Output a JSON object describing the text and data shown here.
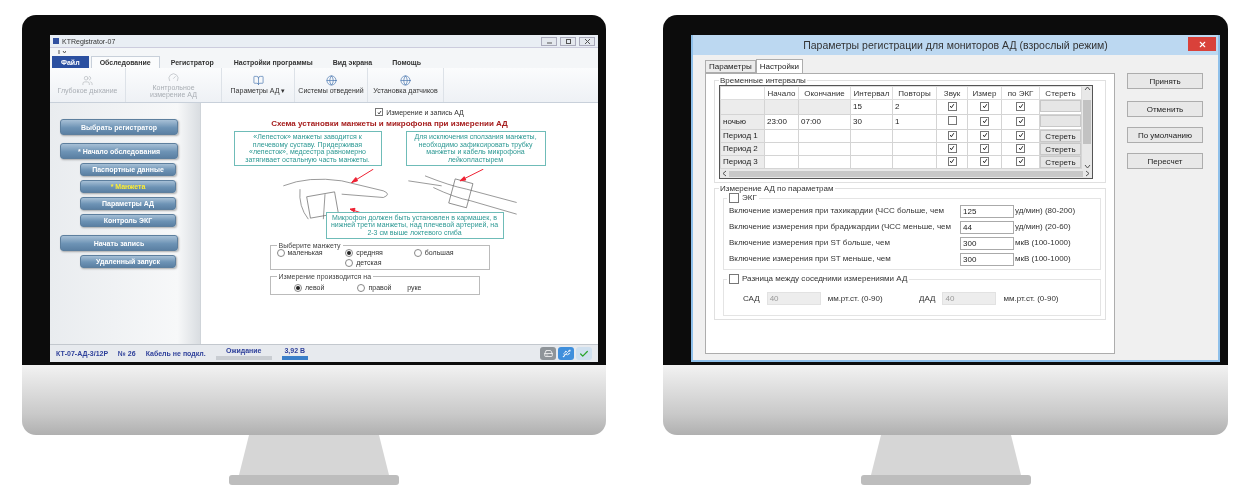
{
  "left_screen": {
    "window": {
      "title": "KTRegistrator-07"
    },
    "ribbon_tabs": [
      {
        "label": "Файл",
        "kind": "file",
        "selected": false
      },
      {
        "label": "Обследование",
        "kind": "tab",
        "selected": true
      },
      {
        "label": "Регистратор",
        "kind": "tab",
        "selected": false
      },
      {
        "label": "Настройки программы",
        "kind": "tab",
        "selected": false
      },
      {
        "label": "Вид экрана",
        "kind": "tab",
        "selected": false
      },
      {
        "label": "Помощь",
        "kind": "tab",
        "selected": false
      }
    ],
    "ribbon_buttons": [
      {
        "label": "Глубокое дыхание",
        "kind": "people",
        "disabled": true
      },
      {
        "label": "Контрольное измерение АД",
        "kind": "gauge",
        "disabled": true
      },
      {
        "label": "Параметры АД ▾",
        "kind": "document",
        "disabled": false
      },
      {
        "label": "Системы отведений",
        "kind": "globe",
        "disabled": false
      },
      {
        "label": "Установка датчиков",
        "kind": "globe",
        "disabled": false
      }
    ],
    "sidebar": [
      {
        "label": "Выбрать регистратор",
        "kind": "main",
        "selected": false
      },
      {
        "label": "* Начало обследования",
        "kind": "main",
        "selected": false
      },
      {
        "label": "Паспортные данные",
        "kind": "sub",
        "selected": false
      },
      {
        "label": "* Манжета",
        "kind": "sub",
        "selected": true
      },
      {
        "label": "Параметры АД",
        "kind": "sub",
        "selected": false
      },
      {
        "label": "Контроль ЭКГ",
        "kind": "sub",
        "selected": false
      },
      {
        "label": "Начать запись",
        "kind": "main",
        "selected": false
      },
      {
        "label": "Удаленный запуск",
        "kind": "sub",
        "selected": false
      }
    ],
    "measure_checkbox": {
      "label": "Измерение и запись АД",
      "checked": true
    },
    "heading": "Схема установки манжеты и микрофона  при измерении АД",
    "callouts": [
      "«Лепесток» манжеты заводится к плечевому суставу. Придерживая «лепесток», медсестра равномерно затягивает остальную часть манжеты.",
      "Для исключения сползания манжеты, необходимо зафиксировать трубку манжеты и кабель микрофона лейкопластырем",
      "Микрофон должен быть установлен в кармашек, в нижней трети манжеты, над плечевой артерией, на 2-3 см выше локтевого сгиба"
    ],
    "cuff_group": {
      "title": "Выберите манжету",
      "options": [
        {
          "label": "маленькая",
          "selected": false
        },
        {
          "label": "средняя",
          "selected": true
        },
        {
          "label": "большая",
          "selected": false
        },
        {
          "label": "детская",
          "selected": false
        }
      ]
    },
    "arm_group": {
      "title": "Измерение производится на",
      "options": [
        {
          "label": "левой",
          "selected": true
        },
        {
          "label": "правой",
          "selected": false
        }
      ],
      "suffix": "руке"
    },
    "status_bar": [
      {
        "kind": "text",
        "text": "КТ-07-АД-3/12Р"
      },
      {
        "kind": "text",
        "text": "№ 26"
      },
      {
        "kind": "text",
        "text": "Кабель не подкл."
      },
      {
        "kind": "meter",
        "text": "Ожидание",
        "level": 0
      },
      {
        "kind": "meter",
        "text": "3,92 В",
        "level": 1
      }
    ]
  },
  "right_screen": {
    "window": {
      "title": "Параметры регистрации для мониторов АД (взрослый режим)"
    },
    "tabs": [
      {
        "label": "Параметры",
        "selected": false
      },
      {
        "label": "Настройки",
        "selected": true
      }
    ],
    "intervals": {
      "title": "Временные интервалы",
      "columns": [
        "Начало",
        "Окончание",
        "Интервал",
        "Повторы",
        "Звук",
        "Измер",
        "по ЭКГ",
        "Стереть"
      ],
      "rows": [
        {
          "disabled": true,
          "interval": "15",
          "repeats": "2",
          "sound": true,
          "measure": true,
          "ecg": true
        },
        {
          "disabled": false,
          "name": "ночью",
          "start": "23:00",
          "end": "07:00",
          "interval": "30",
          "repeats": "1",
          "sound": false,
          "measure": true,
          "ecg": true
        },
        {
          "disabled": false,
          "name": "Период 1",
          "sound": true,
          "measure": true,
          "ecg": true,
          "erase": "Стереть"
        },
        {
          "disabled": false,
          "name": "Период 2",
          "sound": true,
          "measure": true,
          "ecg": true,
          "erase": "Стереть"
        },
        {
          "disabled": false,
          "name": "Период 3",
          "sound": true,
          "measure": true,
          "ecg": true,
          "erase": "Стереть"
        }
      ]
    },
    "params": {
      "title": "Измерение АД по параметрам",
      "ecg": {
        "label": "ЭКГ",
        "checked": false
      },
      "rows": [
        {
          "label": "Включение измерения при тахикардии (ЧСС больше, чем",
          "value": "125",
          "unit": "уд/мин) (80-200)"
        },
        {
          "label": "Включение измерения при брадикардии (ЧСС меньше, чем",
          "value": "44",
          "unit": "уд/мин) (20-60)"
        },
        {
          "label": "Включение измерения при ST больше, чем",
          "value": "300",
          "unit": "мкВ (100-1000)"
        },
        {
          "label": "Включение измерения при ST меньше, чем",
          "value": "300",
          "unit": "мкВ (100-1000)"
        }
      ]
    },
    "difference": {
      "label": "Разница между соседними измерениями АД",
      "checked": false,
      "fields": [
        {
          "label": "САД",
          "value": "40",
          "unit": "мм.рт.ст. (0-90)"
        },
        {
          "label": "ДАД",
          "value": "40",
          "unit": "мм.рт.ст. (0-90)"
        }
      ]
    },
    "buttons": [
      "Принять",
      "Отменить",
      "По умолчанию",
      "Пересчет"
    ]
  }
}
